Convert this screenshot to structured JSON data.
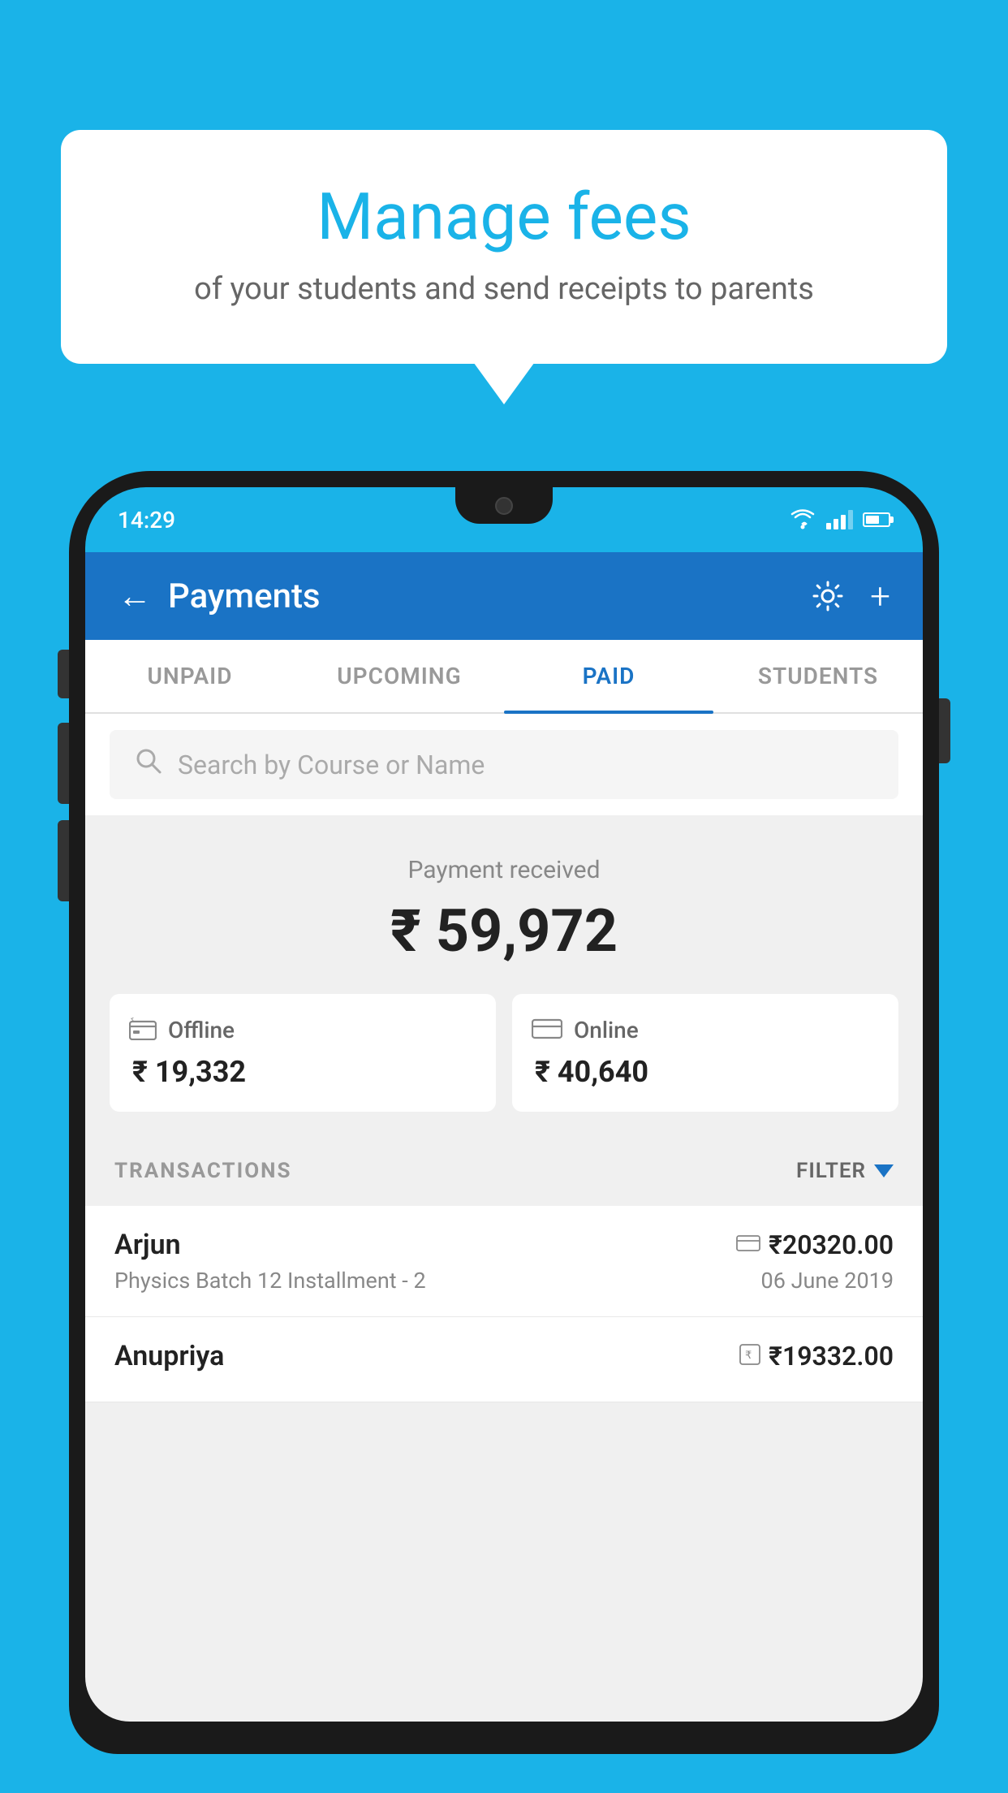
{
  "background_color": "#1ab3e8",
  "speech_bubble": {
    "title": "Manage fees",
    "subtitle": "of your students and send receipts to parents"
  },
  "phone": {
    "status_bar": {
      "time": "14:29"
    },
    "header": {
      "title": "Payments",
      "back_label": "←",
      "gear_label": "⚙",
      "plus_label": "+"
    },
    "tabs": [
      {
        "label": "UNPAID",
        "active": false
      },
      {
        "label": "UPCOMING",
        "active": false
      },
      {
        "label": "PAID",
        "active": true
      },
      {
        "label": "STUDENTS",
        "active": false
      }
    ],
    "search": {
      "placeholder": "Search by Course or Name"
    },
    "payment_summary": {
      "label": "Payment received",
      "amount": "₹ 59,972",
      "offline": {
        "label": "Offline",
        "amount": "₹ 19,332"
      },
      "online": {
        "label": "Online",
        "amount": "₹ 40,640"
      }
    },
    "transactions": {
      "section_label": "TRANSACTIONS",
      "filter_label": "FILTER",
      "rows": [
        {
          "name": "Arjun",
          "detail": "Physics Batch 12 Installment - 2",
          "amount": "₹20320.00",
          "date": "06 June 2019",
          "icon": "card"
        },
        {
          "name": "Anupriya",
          "detail": "",
          "amount": "₹19332.00",
          "date": "",
          "icon": "rupee"
        }
      ]
    }
  }
}
